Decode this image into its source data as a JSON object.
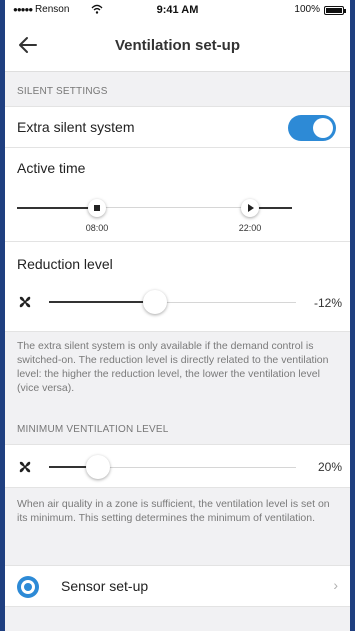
{
  "status_bar": {
    "carrier": "Renson",
    "time": "9:41 AM",
    "battery": "100%"
  },
  "nav": {
    "title": "Ventilation set-up"
  },
  "silent_settings": {
    "header": "SILENT SETTINGS",
    "extra_silent_label": "Extra silent system",
    "extra_silent_enabled": true,
    "active_time_label": "Active time",
    "active_time_start": "08:00",
    "active_time_end": "22:00",
    "reduction_label": "Reduction level",
    "reduction_value": "-12%",
    "reduction_fraction": 0.43,
    "description": "The extra silent system is only available if the demand control is switched-on. The reduction level is directly related to the ventilation level: the higher the reduction level, the lower the ventilation level (vice versa)."
  },
  "minimum_ventilation": {
    "header": "MINIMUM VENTILATION LEVEL",
    "value": "20%",
    "fraction": 0.2,
    "description": "When air quality in a zone is sufficient, the ventilation level is set on its minimum. This setting determines the minimum of ventilation."
  },
  "sensor": {
    "label": "Sensor set-up",
    "chevron": "›"
  },
  "colors": {
    "accent": "#2d8ad6",
    "frame": "#1f3f80"
  }
}
